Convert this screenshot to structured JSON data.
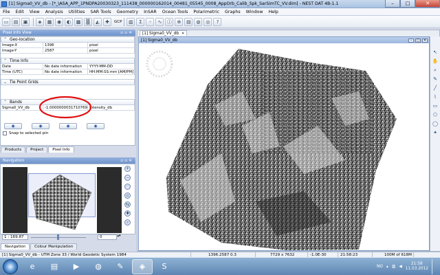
{
  "window": {
    "title": "[1] Sigma0_VV_db - [*_\\ASA_APP_1PNDPA20030323_111438_000000162014_00481_05545_0008_AppOrb_Calib_Spk_SarSimTC_VV.dim] - NEST DAT 4B-1.1",
    "minimize": "–",
    "maximize": "□",
    "close": "✕"
  },
  "menu": [
    "File",
    "Edit",
    "View",
    "Analysis",
    "Utilities",
    "SAR Tools",
    "Geometry",
    "InSAR",
    "Ocean Tools",
    "Polarimetric",
    "Graphs",
    "Window",
    "Help"
  ],
  "toolbar": {
    "gcp_label": "GCP"
  },
  "pixel_info": {
    "header": "Pixel Info View",
    "geo_location": {
      "title": "Geo-location",
      "rows": [
        {
          "name": "Image-X",
          "value": "1396",
          "unit": "pixel"
        },
        {
          "name": "Image-Y",
          "value": "2587",
          "unit": "pixel"
        }
      ]
    },
    "time_info": {
      "title": "Time Info",
      "rows": [
        {
          "name": "Date",
          "value": "No date information",
          "unit": "YYYY-MM-DD"
        },
        {
          "name": "Time (UTC)",
          "value": "No date information",
          "unit": "HH:MM:SS:mm [AM/PM]"
        }
      ]
    },
    "tie_point_grids": {
      "title": "Tie Point Grids"
    },
    "bands": {
      "title": "Bands",
      "rows": [
        {
          "name": "Sigma0_VV_db",
          "value": "-1.0000000031710769...",
          "unit": "Intensity_db"
        }
      ]
    },
    "snap_label": "Snap to selected pin"
  },
  "left_tabs": [
    "Products",
    "Project",
    "Pixel Info"
  ],
  "navigation": {
    "header": "Navigation",
    "zoom_value": "1 : 169.87",
    "rotation_value": "0",
    "tabs": [
      "Navigation",
      "Colour Manipulation"
    ]
  },
  "document": {
    "tab_label": "[1] Sigma0_VV_db",
    "window_title": "[1] Sigma0_VV_db"
  },
  "status": {
    "left": "[1] Sigma0_VV_db - UTM Zone 33 / World Geodetic System 1984",
    "coords": "1396.2587 0.3",
    "size": "7729 x 7632",
    "value": "-1.0E-30",
    "time": "21:58:23",
    "memory": "100M of 618M"
  },
  "taskbar": {
    "lang": "NO",
    "time": "21:58",
    "date": "11.03.2012"
  },
  "colors": {
    "titlebar": "#a9c2e2",
    "annotation_circle": "#e01010",
    "panel_header": "#6f93cc"
  }
}
